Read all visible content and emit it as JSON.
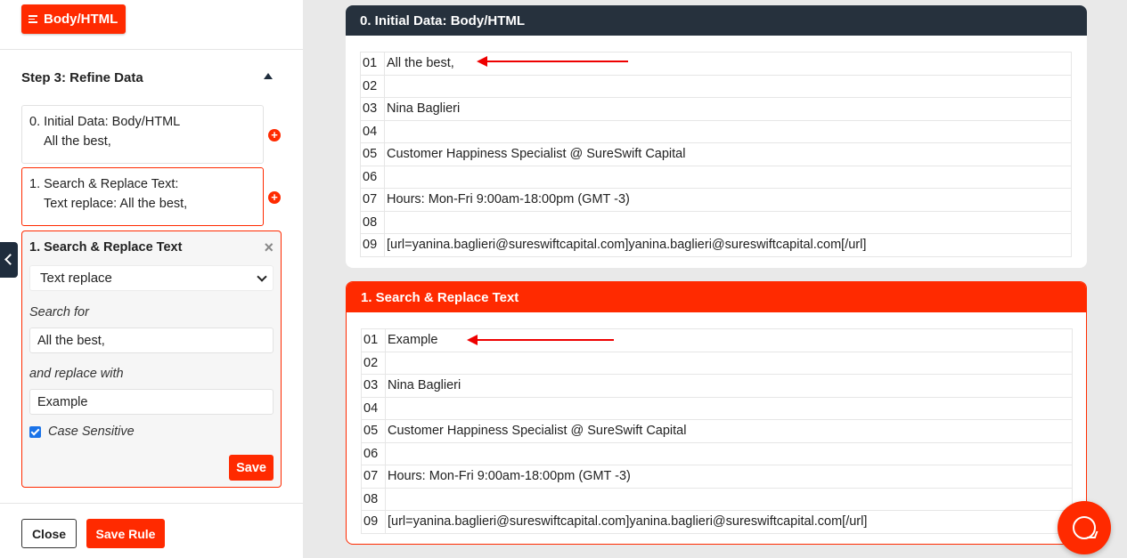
{
  "sidebar": {
    "top_button_label": "Body/HTML",
    "step_title": "Step 3: Refine Data",
    "cards": [
      {
        "title": "0. Initial Data: Body/HTML",
        "subtitle": "All the best,"
      },
      {
        "title": "1. Search & Replace Text:",
        "subtitle": "Text replace: All the best,"
      }
    ],
    "editor": {
      "title": "1. Search & Replace Text",
      "mode_selected": "Text replace",
      "search_label": "Search for",
      "search_value": "All the best,",
      "replace_label": "and replace with",
      "replace_value": "Example",
      "case_sensitive_label": "Case Sensitive",
      "case_sensitive_checked": true,
      "save_label": "Save"
    },
    "footer": {
      "close_label": "Close",
      "save_rule_label": "Save Rule"
    }
  },
  "previews": [
    {
      "title": "0. Initial Data: Body/HTML",
      "lines": [
        {
          "num": "01",
          "text": "All the best,"
        },
        {
          "num": "02",
          "text": ""
        },
        {
          "num": "03",
          "text": "Nina Baglieri"
        },
        {
          "num": "04",
          "text": ""
        },
        {
          "num": "05",
          "text": "Customer Happiness Specialist @ SureSwift Capital"
        },
        {
          "num": "06",
          "text": ""
        },
        {
          "num": "07",
          "text": "Hours: Mon-Fri 9:00am-18:00pm (GMT -3)"
        },
        {
          "num": "08",
          "text": ""
        },
        {
          "num": "09",
          "text": "[url=yanina.baglieri@sureswiftcapital.com]yanina.baglieri@sureswiftcapital.com[/url]"
        }
      ]
    },
    {
      "title": "1. Search & Replace Text",
      "lines": [
        {
          "num": "01",
          "text": "Example"
        },
        {
          "num": "02",
          "text": ""
        },
        {
          "num": "03",
          "text": "Nina Baglieri"
        },
        {
          "num": "04",
          "text": ""
        },
        {
          "num": "05",
          "text": "Customer Happiness Specialist @ SureSwift Capital"
        },
        {
          "num": "06",
          "text": ""
        },
        {
          "num": "07",
          "text": "Hours: Mon-Fri 9:00am-18:00pm (GMT -3)"
        },
        {
          "num": "08",
          "text": ""
        },
        {
          "num": "09",
          "text": "[url=yanina.baglieri@sureswiftcapital.com]yanina.baglieri@sureswiftcapital.com[/url]"
        }
      ]
    }
  ],
  "colors": {
    "accent": "#ff2a00",
    "dark_header": "#26313d",
    "annotation_arrow": "#e00000"
  }
}
